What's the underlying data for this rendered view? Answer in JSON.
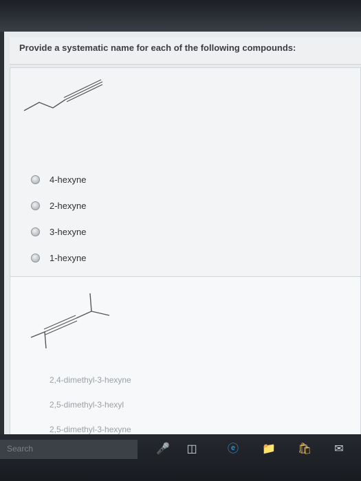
{
  "prompt": "Provide a systematic name for each of the following compounds:",
  "question1": {
    "options": [
      "4-hexyne",
      "2-hexyne",
      "3-hexyne",
      "1-hexyne"
    ]
  },
  "question2": {
    "options": [
      "2,4-dimethyl-3-hexyne",
      "2,5-dimethyl-3-hexyl",
      "2,5-dimethyl-3-hexyne"
    ]
  },
  "taskbar": {
    "search_placeholder": "Search",
    "icons": [
      "microphone-icon",
      "task-view-icon",
      "edge-browser-icon",
      "file-explorer-icon",
      "store-icon",
      "mail-icon"
    ]
  }
}
